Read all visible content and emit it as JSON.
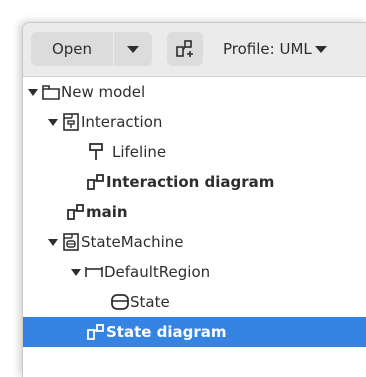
{
  "toolbar": {
    "open_label": "Open",
    "profile_label": "Profile: UML"
  },
  "tree": {
    "items": [
      {
        "label": "New model",
        "icon": "package-icon",
        "expanded": true
      },
      {
        "label": "Interaction",
        "icon": "interaction-icon",
        "expanded": true
      },
      {
        "label": "Lifeline",
        "icon": "lifeline-icon"
      },
      {
        "label": "Interaction diagram",
        "icon": "diagram-icon",
        "bold": true
      },
      {
        "label": "main",
        "icon": "diagram-icon",
        "bold": true
      },
      {
        "label": "StateMachine",
        "icon": "state-machine-icon",
        "expanded": true
      },
      {
        "label": "DefaultRegion",
        "icon": "region-icon",
        "expanded": true
      },
      {
        "label": "State",
        "icon": "state-icon"
      },
      {
        "label": "State diagram",
        "icon": "diagram-icon",
        "bold": true,
        "selected": true
      }
    ]
  },
  "colors": {
    "selection": "#3584e4",
    "header_bg": "#ebebeb",
    "button_bg": "#dcdcdc",
    "text": "#2e2e2e"
  }
}
